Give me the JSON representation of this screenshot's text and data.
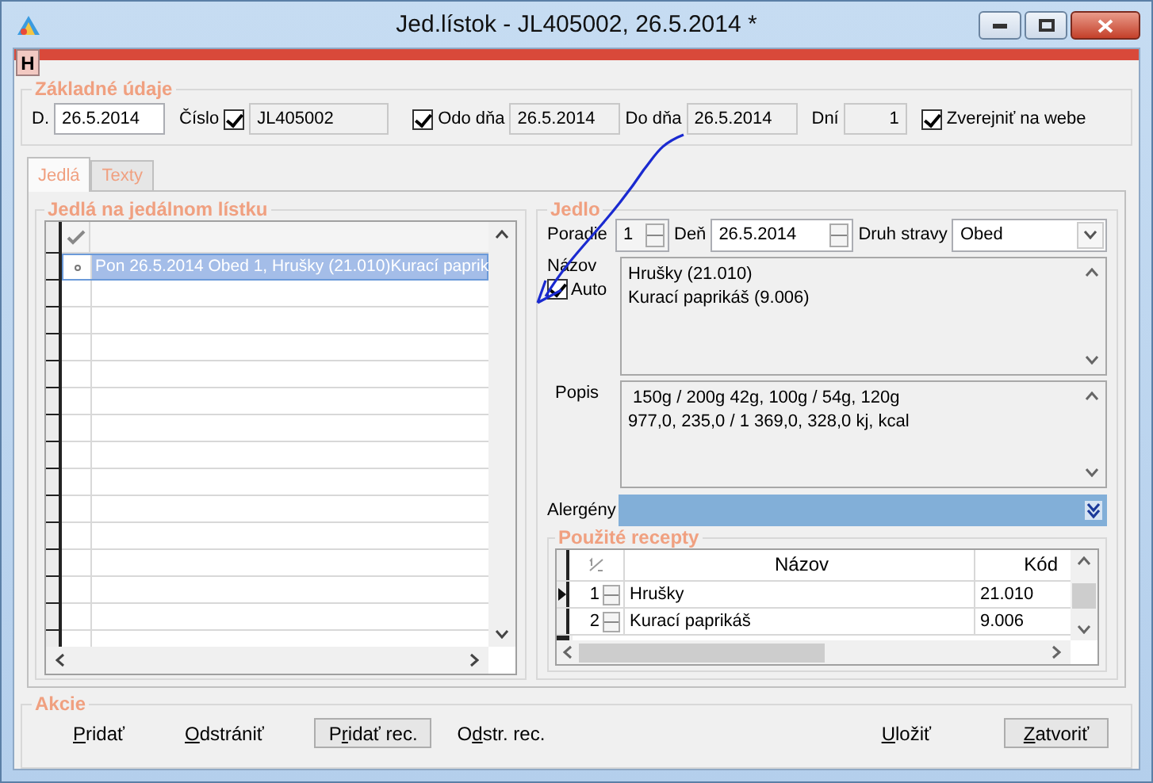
{
  "window": {
    "title": "Jed.lístok - JL405002, 26.5.2014 *"
  },
  "header_button": "H",
  "basic": {
    "title": "Základné údaje",
    "date": {
      "label": "D.",
      "value": "26.5.2014"
    },
    "number": {
      "label": "Číslo",
      "checked": true,
      "value": "JL405002"
    },
    "from": {
      "checked": true,
      "label": "Odo dňa",
      "value": "26.5.2014"
    },
    "to": {
      "label": "Do dňa",
      "value": "26.5.2014"
    },
    "days": {
      "label": "Dní",
      "value": "1"
    },
    "publish": {
      "label": "Zverejniť na webe",
      "checked": true
    }
  },
  "tabs": [
    {
      "label": "Jedlá",
      "selected": true
    },
    {
      "label": "Texty",
      "selected": false
    }
  ],
  "menu_items": {
    "title": "Jedlá na jedálnom lístku",
    "rows": [
      {
        "text": "Pon 26.5.2014 Obed 1, Hrušky (21.010)Kurací paprik",
        "selected": true
      }
    ]
  },
  "meal": {
    "title": "Jedlo",
    "order": {
      "label": "Poradie",
      "value": "1"
    },
    "day": {
      "label": "Deň",
      "value": "26.5.2014"
    },
    "meal_type": {
      "label": "Druh stravy",
      "value": "Obed"
    },
    "name": {
      "label": "Názov",
      "auto_label": "Auto",
      "auto": true,
      "lines": [
        "Hrušky (21.010)",
        "Kurací paprikáš (9.006)"
      ]
    },
    "description": {
      "label": "Popis",
      "lines": [
        " 150g / 200g 42g, 100g / 54g, 120g",
        "977,0, 235,0 / 1 369,0, 328,0 kj, kcal"
      ]
    },
    "allergens": {
      "label": "Alergény"
    }
  },
  "recipes": {
    "title": "Použité recepty",
    "columns": [
      "Názov",
      "Kód"
    ],
    "rows": [
      {
        "order": "1",
        "name": "Hrušky",
        "code": "21.010",
        "selected": true
      },
      {
        "order": "2",
        "name": "Kurací paprikáš",
        "code": "9.006",
        "selected": false
      }
    ]
  },
  "actions": {
    "title": "Akcie",
    "left": [
      {
        "underlined": "P",
        "after": "ridať",
        "kind": "link"
      },
      {
        "underlined": "O",
        "after": "dstrániť",
        "kind": "link"
      },
      {
        "before": "P",
        "underlined": "r",
        "after": "idať rec.",
        "kind": "button"
      },
      {
        "before": "O",
        "underlined": "d",
        "after": "str. rec.",
        "kind": "link"
      }
    ],
    "right": [
      {
        "underlined": "U",
        "after": "ložiť",
        "kind": "link"
      },
      {
        "underlined": "Z",
        "after": "atvoriť",
        "kind": "button"
      }
    ]
  }
}
